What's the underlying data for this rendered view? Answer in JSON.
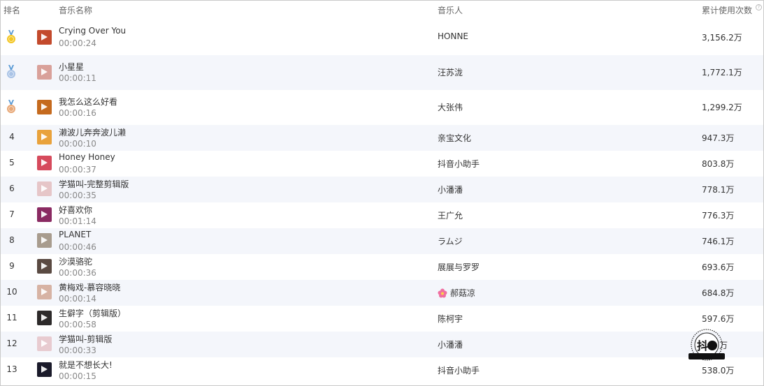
{
  "header": {
    "rank": "排名",
    "title": "音乐名称",
    "artist": "音乐人",
    "uses": "累计使用次数",
    "help_icon": "?"
  },
  "colors": {
    "gold_medal": "#f3c623",
    "silver_medal": "#a9c3e6",
    "bronze_medal": "#e8a877",
    "ribbon_blue": "#5b9bd5",
    "alt_row_bg": "#f4f6fb"
  },
  "rows": [
    {
      "rank": "",
      "medal": "gold-medal-icon",
      "title": "Crying Over You",
      "duration": "00:00:24",
      "artist": "HONNE",
      "uses": "3,156.2万",
      "cover": "#c34a2c"
    },
    {
      "rank": "",
      "medal": "silver-medal-icon",
      "title": "小星星",
      "duration": "00:00:11",
      "artist": "汪苏泷",
      "uses": "1,772.1万",
      "cover": "#d9a19a"
    },
    {
      "rank": "",
      "medal": "bronze-medal-icon",
      "title": "我怎么这么好看",
      "duration": "00:00:16",
      "artist": "大张伟",
      "uses": "1,299.2万",
      "cover": "#c56a1e"
    },
    {
      "rank": "4",
      "title": "濑波儿奔奔波儿濑",
      "duration": "00:00:10",
      "artist": "亲宝文化",
      "uses": "947.3万",
      "cover": "#e9a23b"
    },
    {
      "rank": "5",
      "title": "Honey Honey",
      "duration": "00:00:37",
      "artist": "抖音小助手",
      "uses": "803.8万",
      "cover": "#d64a5c"
    },
    {
      "rank": "6",
      "title": "学猫叫-完整剪辑版",
      "duration": "00:00:35",
      "artist": "小潘潘",
      "uses": "778.1万",
      "cover": "#e6c6c8"
    },
    {
      "rank": "7",
      "title": "好喜欢你",
      "duration": "00:01:14",
      "artist": "王广允",
      "uses": "776.3万",
      "cover": "#8a2a62"
    },
    {
      "rank": "8",
      "title": "PLANET",
      "duration": "00:00:46",
      "artist": "ラムジ",
      "uses": "746.1万",
      "cover": "#a89c8e"
    },
    {
      "rank": "9",
      "title": "沙漠骆驼",
      "duration": "00:00:36",
      "artist": "展展与罗罗",
      "uses": "693.6万",
      "cover": "#5a4a42"
    },
    {
      "rank": "10",
      "title": "黄梅戏-慕容晓晓",
      "duration": "00:00:14",
      "artist": "郝菇凉",
      "uses": "684.8万",
      "cover": "#d7b3a4",
      "artist_flower": true
    },
    {
      "rank": "11",
      "title": "生僻字（剪辑版）",
      "duration": "00:00:58",
      "artist": "陈柯宇",
      "uses": "597.6万",
      "cover": "#2d2a2a"
    },
    {
      "rank": "12",
      "title": "学猫叫-剪辑版",
      "duration": "00:00:33",
      "artist": "小潘潘",
      "uses": "",
      "cover": "#e8cbd0"
    },
    {
      "rank": "13",
      "title": "就是不想长大!",
      "duration": "00:00:15",
      "artist": "抖音小助手",
      "uses": "538.0万",
      "cover": "#1a1a2a"
    }
  ],
  "watermark": {
    "main": "抖",
    "uses_tail": "万"
  }
}
